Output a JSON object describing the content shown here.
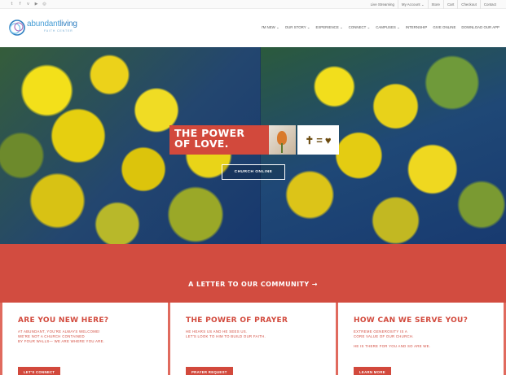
{
  "social": {
    "icons": [
      {
        "name": "twitter-icon",
        "glyph": "t"
      },
      {
        "name": "facebook-icon",
        "glyph": "f"
      },
      {
        "name": "vimeo-icon",
        "glyph": "v"
      },
      {
        "name": "youtube-icon",
        "glyph": "▶"
      },
      {
        "name": "instagram-icon",
        "glyph": "◎"
      }
    ]
  },
  "utility": {
    "links": [
      "Live Streaming",
      "My Account ⌄",
      "Store",
      "Cart",
      "Checkout",
      "Contact"
    ]
  },
  "logo": {
    "word1": "abundant",
    "word2": "living",
    "sub": "FAITH CENTER"
  },
  "nav": {
    "items": [
      "I'M NEW ⌄",
      "OUR STORY ⌄",
      "EXPERIENCE ⌄",
      "CONNECT ⌄",
      "CAMPUSES ⌄",
      "INTERNSHIP",
      "GIVE ONLINE",
      "DOWNLOAD OUR APP"
    ]
  },
  "hero": {
    "line1": "THE POWER",
    "line2": "OF LOVE.",
    "equation": {
      "left": "✝",
      "eq": "=",
      "right": "♥"
    },
    "button": "CHURCH ONLINE"
  },
  "community": {
    "link": "A LETTER TO OUR COMMUNITY →"
  },
  "cards": [
    {
      "title": "ARE YOU NEW HERE?",
      "lines": [
        "AT ABUNDANT, YOU'RE ALWAYS WELCOME!",
        "WE'RE NOT A CHURCH CONTAINED",
        "BY FOUR WALLS— WE ARE WHERE YOU ARE."
      ],
      "button": "LET'S CONNECT"
    },
    {
      "title": "THE POWER OF PRAYER",
      "lines": [
        "HE HEARS US AND HE SEES US.",
        "LET'S LOOK TO HIM TO BUILD OUR FAITH."
      ],
      "button": "PRAYER REQUEST"
    },
    {
      "title": "HOW CAN WE SERVE YOU?",
      "lines": [
        "EXTREME GENEROSITY IS A",
        "CORE VALUE OF OUR CHURCH.",
        "",
        "HE IS THERE FOR YOU AND SO ARE WE."
      ],
      "button": "LEARN MORE"
    }
  ],
  "colors": {
    "accent_red": "#d2493c",
    "logo_blue": "#4a9fd6"
  }
}
